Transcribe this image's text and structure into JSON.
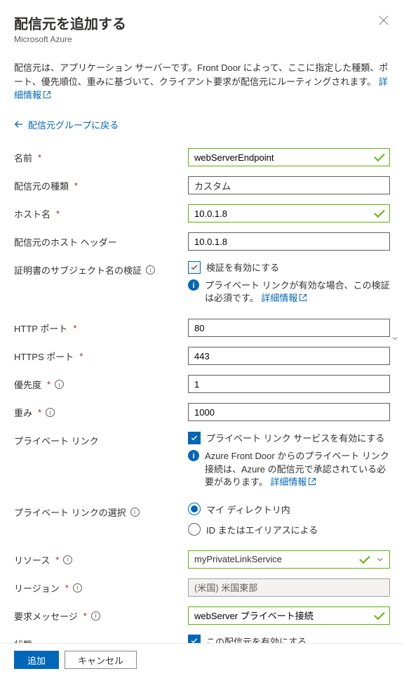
{
  "header": {
    "title": "配信元を追加する",
    "subtitle": "Microsoft Azure"
  },
  "intro": {
    "text": "配信元は、アプリケーション サーバーです。Front Door によって、ここに指定した種類、ポート、優先順位、重みに基づいて、クライアント要求が配信元にルーティングされます。",
    "link": "詳細情報"
  },
  "back": {
    "label": "配信元グループに戻る"
  },
  "form": {
    "name": {
      "label": "名前",
      "value": "webServerEndpoint"
    },
    "originType": {
      "label": "配信元の種類",
      "value": "カスタム"
    },
    "hostName": {
      "label": "ホスト名",
      "value": "10.0.1.8"
    },
    "hostHeader": {
      "label": "配信元のホスト ヘッダー",
      "value": "10.0.1.8"
    },
    "certSubject": {
      "label": "証明書のサブジェクト名の検証",
      "checkbox": "検証を有効にする",
      "note": "プライベート リンクが有効な場合、この検証は必須です。",
      "noteLink": "詳細情報"
    },
    "httpPort": {
      "label": "HTTP ポート",
      "value": "80"
    },
    "httpsPort": {
      "label": "HTTPS ポート",
      "value": "443"
    },
    "priority": {
      "label": "優先度",
      "value": "1"
    },
    "weight": {
      "label": "重み",
      "value": "1000"
    },
    "privateLink": {
      "label": "プライベート リンク",
      "checkbox": "プライベート リンク サービスを有効にする",
      "note": "Azure Front Door からのプライベート リンク接続は、Azure の配信元で承認されている必要があります。",
      "noteLink": "詳細情報"
    },
    "plSelect": {
      "label": "プライベート リンクの選択",
      "opt1": "マイ ディレクトリ内",
      "opt2": "ID またはエイリアスによる"
    },
    "resource": {
      "label": "リソース",
      "value": "myPrivateLinkService"
    },
    "region": {
      "label": "リージョン",
      "value": "(米国) 米国東部"
    },
    "reqMsg": {
      "label": "要求メッセージ",
      "value": "webServer プライベート接続"
    },
    "state": {
      "label": "状態",
      "checkbox": "この配信元を有効にする"
    }
  },
  "footer": {
    "add": "追加",
    "cancel": "キャンセル"
  }
}
